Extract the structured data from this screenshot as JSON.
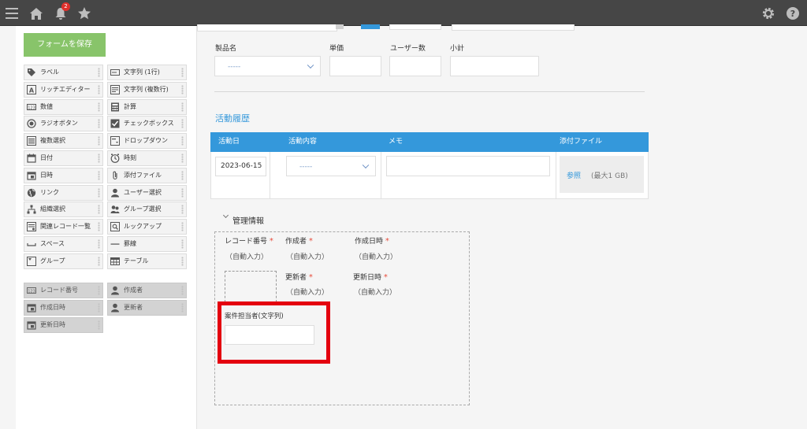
{
  "topbar": {
    "menu_icon": "hamburger-icon",
    "home_icon": "home-icon",
    "bell_icon": "bell-icon",
    "notification_count": "2",
    "star_icon": "star-icon",
    "gear_icon": "gear-icon",
    "help_icon": "help-icon"
  },
  "palette": {
    "save_label": "フォームを保存",
    "fields": [
      {
        "label": "ラベル",
        "icon": "tag-icon"
      },
      {
        "label": "文字列 (1行)",
        "icon": "text-single-line-icon"
      },
      {
        "label": "リッチエディター",
        "icon": "rich-editor-icon"
      },
      {
        "label": "文字列 (複数行)",
        "icon": "text-multi-line-icon"
      },
      {
        "label": "数値",
        "icon": "number-icon"
      },
      {
        "label": "計算",
        "icon": "calculator-icon"
      },
      {
        "label": "ラジオボタン",
        "icon": "radio-icon"
      },
      {
        "label": "チェックボックス",
        "icon": "checkbox-icon"
      },
      {
        "label": "複数選択",
        "icon": "multi-select-icon"
      },
      {
        "label": "ドロップダウン",
        "icon": "dropdown-icon"
      },
      {
        "label": "日付",
        "icon": "date-icon"
      },
      {
        "label": "時刻",
        "icon": "clock-icon"
      },
      {
        "label": "日時",
        "icon": "datetime-icon"
      },
      {
        "label": "添付ファイル",
        "icon": "paperclip-icon"
      },
      {
        "label": "リンク",
        "icon": "globe-icon"
      },
      {
        "label": "ユーザー選択",
        "icon": "user-icon"
      },
      {
        "label": "組織選択",
        "icon": "org-icon"
      },
      {
        "label": "グループ選択",
        "icon": "group-icon"
      },
      {
        "label": "関連レコード一覧",
        "icon": "related-records-icon"
      },
      {
        "label": "ルックアップ",
        "icon": "lookup-icon"
      },
      {
        "label": "スペース",
        "icon": "space-icon"
      },
      {
        "label": "罫線",
        "icon": "border-line-icon"
      },
      {
        "label": "グループ",
        "icon": "group-field-icon"
      },
      {
        "label": "テーブル",
        "icon": "table-icon"
      }
    ],
    "system_fields": [
      {
        "label": "レコード番号",
        "icon": "record-number-icon"
      },
      {
        "label": "作成者",
        "icon": "user-icon"
      },
      {
        "label": "作成日時",
        "icon": "datetime-icon"
      },
      {
        "label": "更新者",
        "icon": "user-icon"
      },
      {
        "label": "更新日時",
        "icon": "datetime-icon"
      }
    ]
  },
  "product": {
    "product_label": "製品名",
    "product_value": "-----",
    "price_label": "単価",
    "users_label": "ユーザー数",
    "subtotal_label": "小計"
  },
  "activity": {
    "title": "活動履歴",
    "columns": [
      "活動日",
      "活動内容",
      "メモ",
      "添付ファイル"
    ],
    "row": {
      "date": "2023-06-15",
      "content": "-----",
      "memo": "",
      "browse_label": "参照",
      "max_size": "(最大1 GB)"
    }
  },
  "management": {
    "title": "管理情報",
    "record_number_label": "レコード番号",
    "creator_label": "作成者",
    "created_at_label": "作成日時",
    "updater_label": "更新者",
    "updated_at_label": "更新日時",
    "auto_text": "（自動入力）",
    "required_mark": "*",
    "case_owner_label": "案件担当者(文字列)",
    "highlight_color": "#e4000f"
  }
}
